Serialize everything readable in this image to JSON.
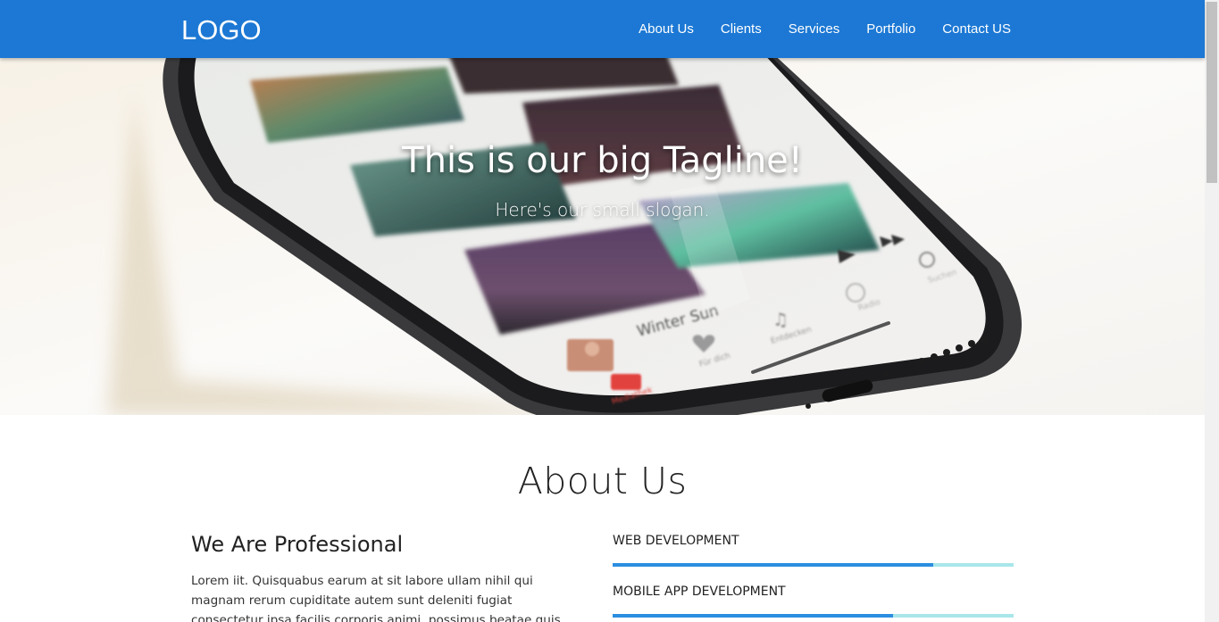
{
  "header": {
    "logo": "LOGO",
    "nav": [
      "About Us",
      "Clients",
      "Services",
      "Portfolio",
      "Contact US"
    ]
  },
  "hero": {
    "title": "This is our big Tagline!",
    "subtitle": "Here's our small slogan.",
    "phone_screen": {
      "song_title": "Winter Sun",
      "tabs": [
        "Mediathek",
        "Für dich",
        "Entdecken",
        "Radio",
        "Suchen"
      ]
    }
  },
  "about": {
    "title": "About Us",
    "heading": "We Are Professional",
    "body": "Lorem iit. Quisquabus earum at sit labore ullam nihil qui magnam rerum cupiditate autem sunt deleniti fugiat consectetur ipsa facilis corporis animi, possimus beatae quis officia, architecto? Reiciendis",
    "skills": [
      {
        "label": "WEB DEVELOPMENT",
        "percent": 80
      },
      {
        "label": "MOBILE APP DEVELOPMENT",
        "percent": 70
      }
    ]
  },
  "colors": {
    "primary": "#1c78d4",
    "skill_fill": "#2b8ee0",
    "skill_track": "#a9e6ea"
  }
}
